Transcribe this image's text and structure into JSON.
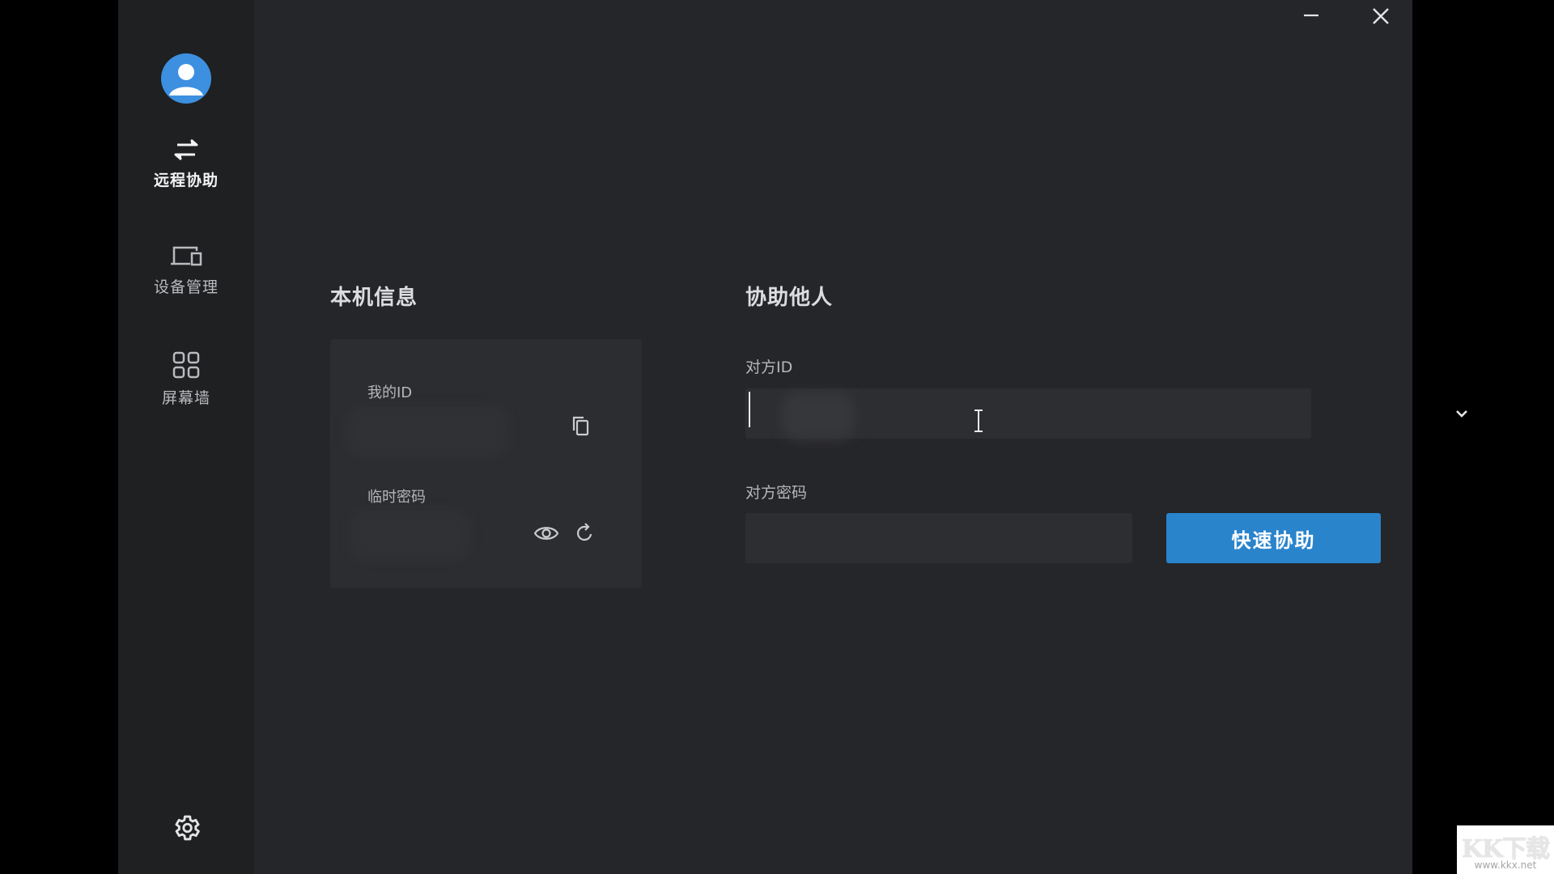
{
  "sidebar": {
    "items": [
      {
        "label": "远程协助",
        "icon": "swap-arrows-icon",
        "active": true
      },
      {
        "label": "设备管理",
        "icon": "devices-icon",
        "active": false
      },
      {
        "label": "屏幕墙",
        "icon": "grid-icon",
        "active": false
      }
    ],
    "settings_icon": "gear-icon"
  },
  "window_controls": {
    "minimize_icon": "minimize-icon",
    "close_icon": "close-icon"
  },
  "local_info": {
    "title": "本机信息",
    "my_id_label": "我的ID",
    "temp_password_label": "临时密码"
  },
  "assist": {
    "title": "协助他人",
    "peer_id_label": "对方ID",
    "peer_id_value": "",
    "peer_password_label": "对方密码",
    "peer_password_value": "",
    "quick_assist_button": "快速协助"
  },
  "watermark": {
    "logo": "KK下载",
    "url": "www.kkx.net"
  },
  "colors": {
    "app_bg": "#252629",
    "sidebar_bg": "#1f2022",
    "card_bg": "#2c2d30",
    "input_bg": "#2d2e31",
    "accent": "#2a84cc",
    "avatar": "#3d8fe0"
  }
}
